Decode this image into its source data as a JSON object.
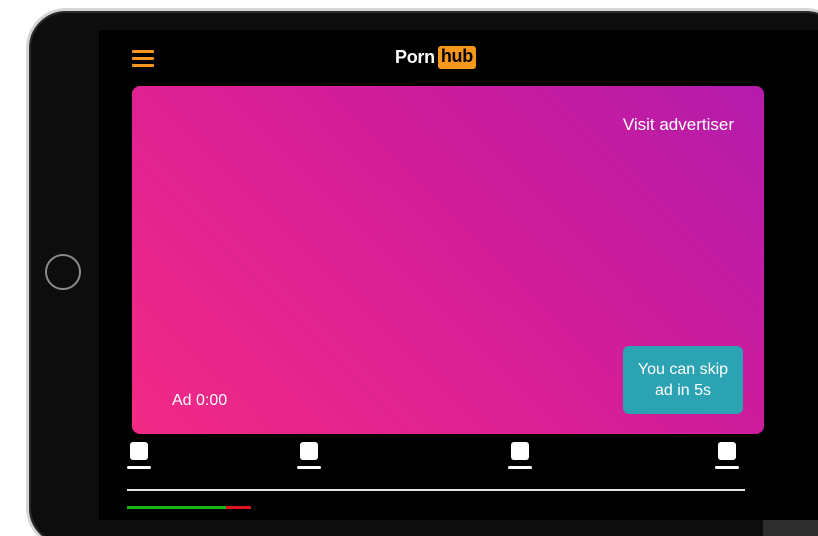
{
  "header": {
    "logo_part1": "Porn",
    "logo_part2": "hub",
    "menu_icon": "hamburger-menu-icon"
  },
  "ad": {
    "visit_advertiser": "Visit advertiser",
    "timer_label": "Ad 0:00",
    "skip_line1": "You can skip",
    "skip_line2": "ad in 5s"
  },
  "thumbnails": [
    {
      "icon": "thumbnail-icon"
    },
    {
      "icon": "thumbnail-icon"
    },
    {
      "icon": "thumbnail-icon"
    },
    {
      "icon": "thumbnail-icon"
    }
  ],
  "progress": {
    "played_fraction": 0.16,
    "marker_fraction": 0.04
  },
  "colors": {
    "accent": "#f7971d",
    "ad_gradient_start": "#b41bab",
    "ad_gradient_end": "#f32a86",
    "skip_button": "#2ba3b3",
    "progress_played": "#19b319",
    "progress_marker": "#e0121a"
  }
}
